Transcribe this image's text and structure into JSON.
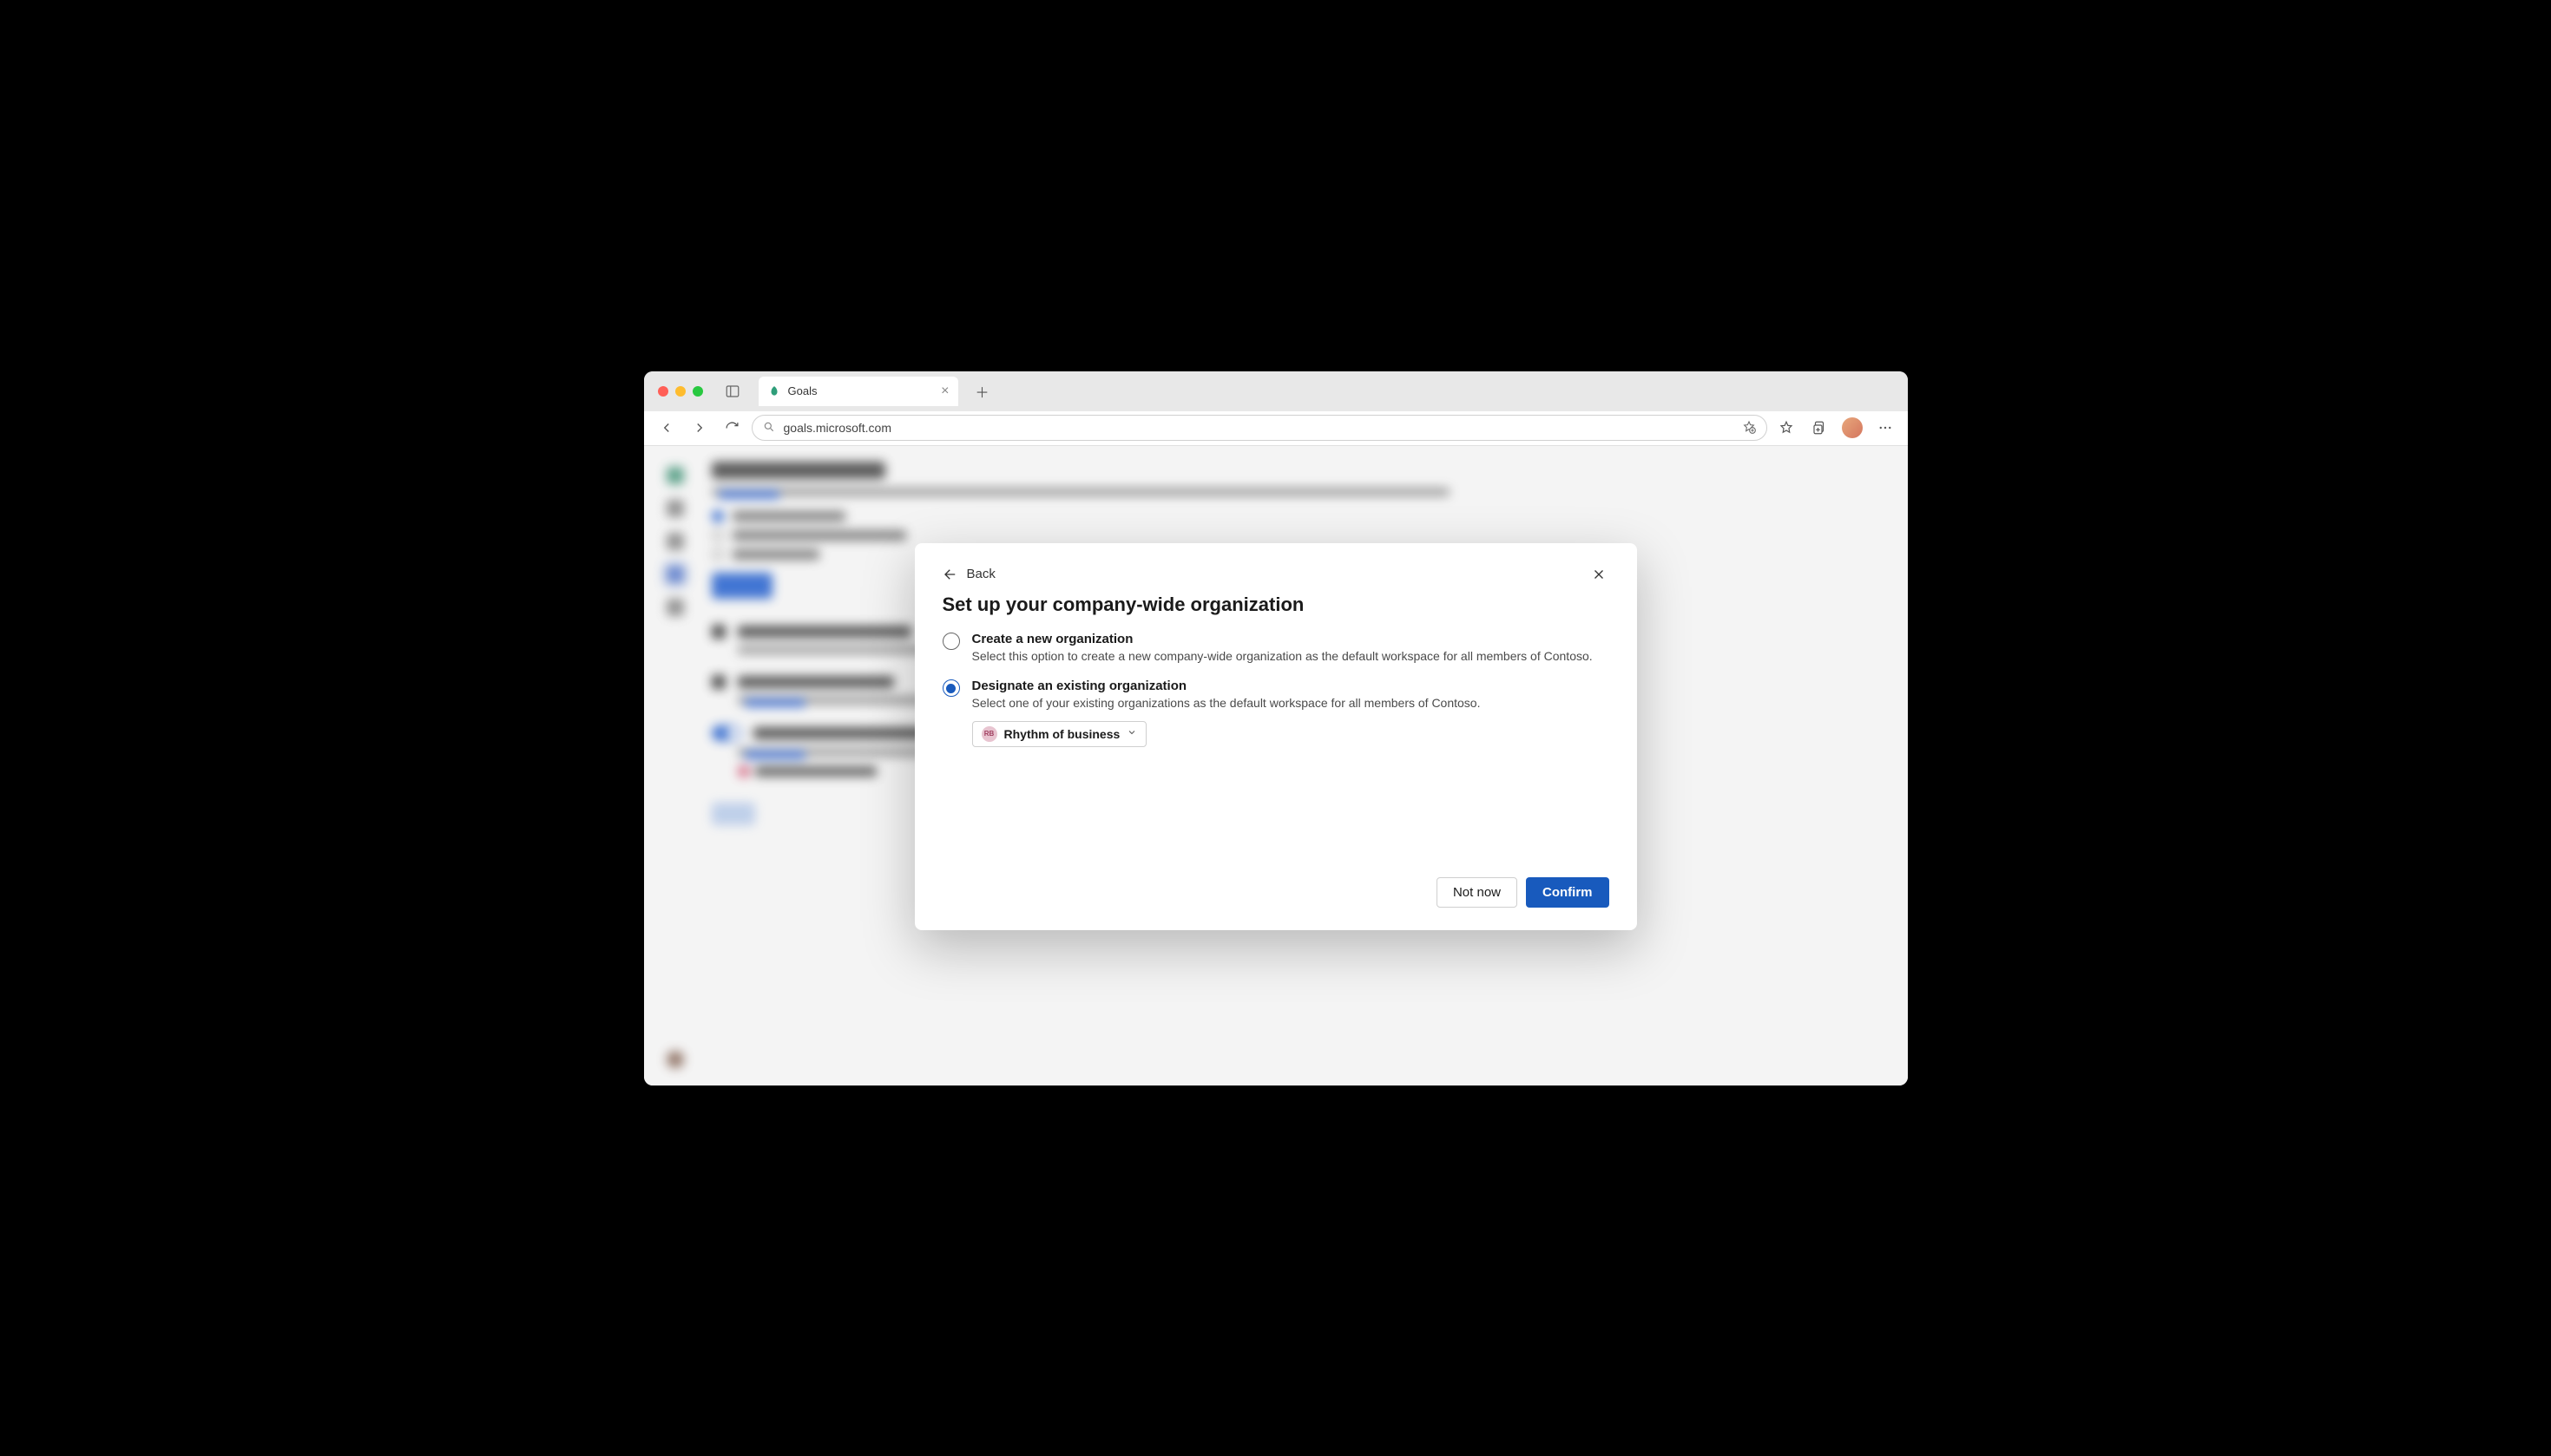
{
  "browser": {
    "tab_title": "Goals",
    "url": "goals.microsoft.com"
  },
  "dialog": {
    "back_label": "Back",
    "title": "Set up your company-wide organization",
    "options": [
      {
        "label": "Create a new organization",
        "description": "Select this option to create a new company-wide organization as the default workspace for all members of Contoso.",
        "selected": false
      },
      {
        "label": "Designate an existing organization",
        "description": "Select one of your existing organizations as the default workspace for all members of Contoso.",
        "selected": true
      }
    ],
    "selected_org": {
      "initials": "RB",
      "name": "Rhythm of business"
    },
    "footer": {
      "secondary": "Not now",
      "primary": "Confirm"
    }
  }
}
